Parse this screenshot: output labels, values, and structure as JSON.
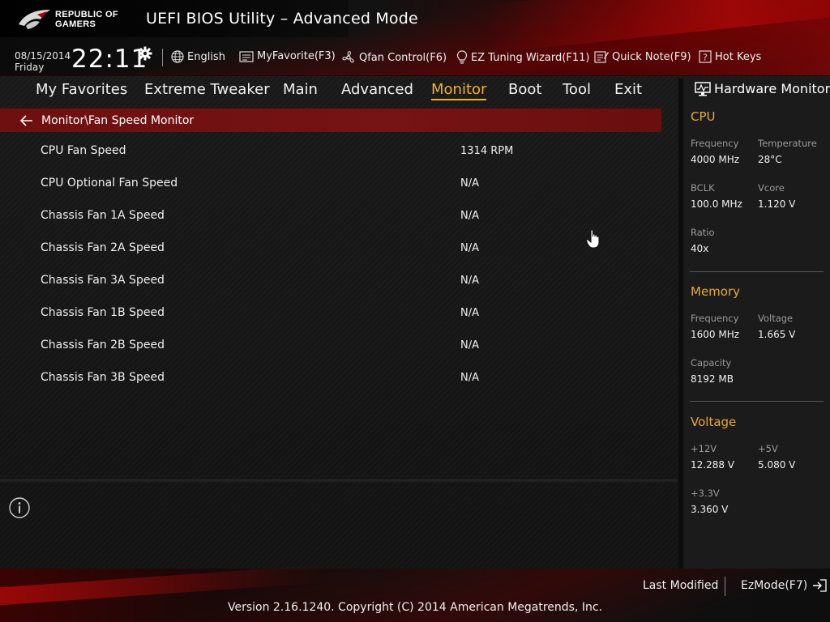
{
  "header": {
    "logo_line1": "REPUBLIC OF",
    "logo_line2": "GAMERS",
    "title": "UEFI BIOS Utility – Advanced Mode",
    "date": "08/15/2014",
    "day": "Friday",
    "time": "22:11",
    "toolbar": {
      "language": "English",
      "myfavorite": "MyFavorite(F3)",
      "qfan": "Qfan Control(F6)",
      "ez_tuning": "EZ Tuning Wizard(F11)",
      "quick_note": "Quick Note(F9)",
      "hot_keys": "Hot Keys"
    }
  },
  "tabs": [
    {
      "label": "My Favorites",
      "active": false
    },
    {
      "label": "Extreme Tweaker",
      "active": false
    },
    {
      "label": "Main",
      "active": false
    },
    {
      "label": "Advanced",
      "active": false
    },
    {
      "label": "Monitor",
      "active": true
    },
    {
      "label": "Boot",
      "active": false
    },
    {
      "label": "Tool",
      "active": false
    },
    {
      "label": "Exit",
      "active": false
    }
  ],
  "breadcrumb": "Monitor\\Fan Speed Monitor",
  "items": [
    {
      "label": "CPU Fan Speed",
      "value": "1314 RPM"
    },
    {
      "label": "CPU Optional Fan Speed",
      "value": "N/A"
    },
    {
      "label": "Chassis Fan 1A Speed",
      "value": "N/A"
    },
    {
      "label": "Chassis Fan 2A Speed",
      "value": "N/A"
    },
    {
      "label": "Chassis Fan 3A Speed",
      "value": "N/A"
    },
    {
      "label": "Chassis Fan 1B Speed",
      "value": "N/A"
    },
    {
      "label": "Chassis Fan 2B Speed",
      "value": "N/A"
    },
    {
      "label": "Chassis Fan 3B Speed",
      "value": "N/A"
    }
  ],
  "hardware_monitor": {
    "title": "Hardware Monitor",
    "cpu": {
      "heading": "CPU",
      "frequency_label": "Frequency",
      "frequency": "4000 MHz",
      "temperature_label": "Temperature",
      "temperature": "28°C",
      "bclk_label": "BCLK",
      "bclk": "100.0 MHz",
      "vcore_label": "Vcore",
      "vcore": "1.120 V",
      "ratio_label": "Ratio",
      "ratio": "40x"
    },
    "memory": {
      "heading": "Memory",
      "frequency_label": "Frequency",
      "frequency": "1600 MHz",
      "voltage_label": "Voltage",
      "voltage": "1.665 V",
      "capacity_label": "Capacity",
      "capacity": "8192 MB"
    },
    "voltage": {
      "heading": "Voltage",
      "v12_label": "+12V",
      "v12": "12.288 V",
      "v5_label": "+5V",
      "v5": "5.080 V",
      "v33_label": "+3.3V",
      "v33": "3.360 V"
    }
  },
  "footer": {
    "last_modified": "Last Modified",
    "ezmode": "EzMode(F7)",
    "copyright": "Version 2.16.1240. Copyright (C) 2014 American Megatrends, Inc."
  },
  "colors": {
    "accent": "#f5b02a",
    "section_heading": "#e8a93a",
    "breadcrumb_bg": "#741213",
    "brand_red": "#c00a0a"
  }
}
